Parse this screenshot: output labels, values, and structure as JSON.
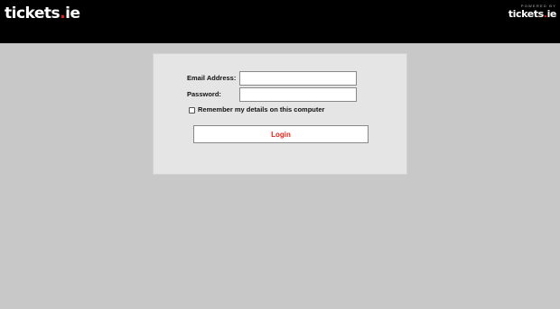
{
  "header": {
    "logo_text": "tickets",
    "logo_dot": ".",
    "logo_tld": "ie",
    "powered_by_text": "POWERED BY",
    "powered_logo_text": "tickets",
    "powered_logo_dot": ".",
    "powered_logo_tld": "ie"
  },
  "login_form": {
    "email_label": "Email Address:",
    "email_value": "",
    "password_label": "Password:",
    "password_value": "",
    "remember_label": "Remember my details on this computer",
    "remember_checked": false,
    "login_button_label": "Login"
  },
  "colors": {
    "header_bg": "#000000",
    "page_bg": "#c8c8c8",
    "panel_bg": "#e5e5e5",
    "accent_red": "#e2231a"
  }
}
